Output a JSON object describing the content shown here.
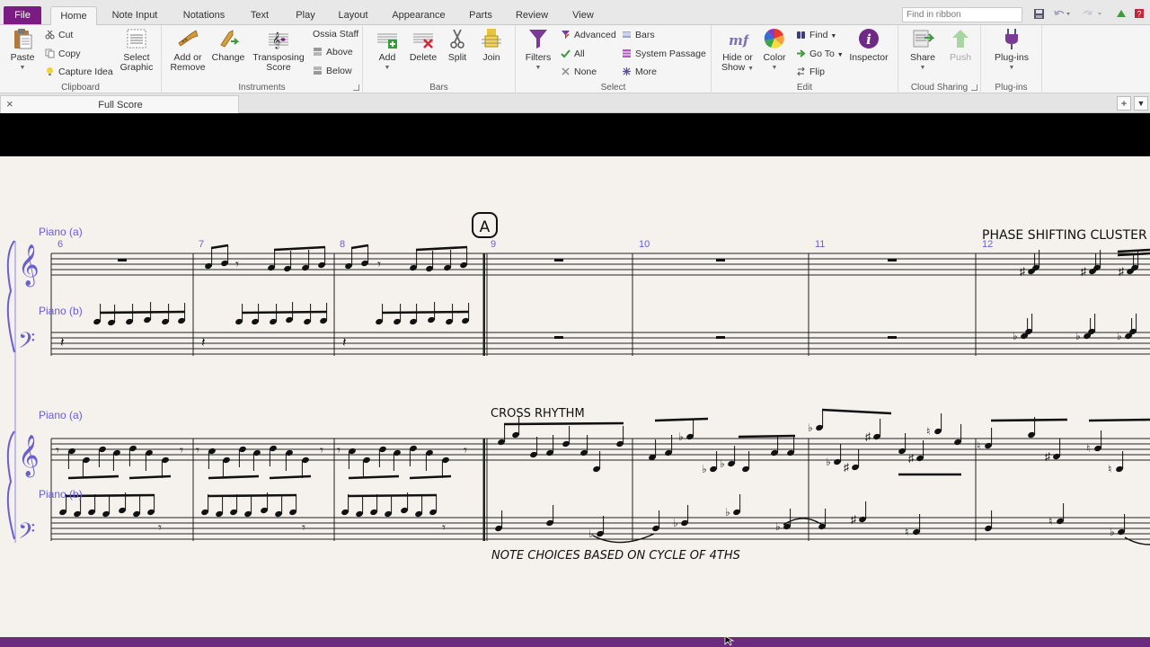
{
  "tabs": {
    "file": "File",
    "items": [
      "Home",
      "Note Input",
      "Notations",
      "Text",
      "Play",
      "Layout",
      "Appearance",
      "Parts",
      "Review",
      "View"
    ],
    "active": "Home"
  },
  "search": {
    "placeholder": "Find in ribbon"
  },
  "ribbon": {
    "clipboard": {
      "label": "Clipboard",
      "paste": "Paste",
      "cut": "Cut",
      "copy": "Copy",
      "capture_idea": "Capture Idea",
      "select_graphic_1": "Select",
      "select_graphic_2": "Graphic"
    },
    "instruments": {
      "label": "Instruments",
      "add_remove_1": "Add or",
      "add_remove_2": "Remove",
      "change": "Change",
      "transposing_1": "Transposing",
      "transposing_2": "Score",
      "ossia": "Ossia Staff",
      "above": "Above",
      "below": "Below"
    },
    "bars": {
      "label": "Bars",
      "add": "Add",
      "delete": "Delete",
      "split": "Split",
      "join": "Join"
    },
    "select": {
      "label": "Select",
      "filters": "Filters",
      "advanced": "Advanced",
      "all": "All",
      "none": "None",
      "bars": "Bars",
      "system_passage": "System Passage",
      "more": "More"
    },
    "edit": {
      "label": "Edit",
      "hide_show_1": "Hide or",
      "hide_show_2": "Show",
      "color": "Color",
      "find": "Find",
      "goto": "Go To",
      "flip": "Flip",
      "inspector": "Inspector"
    },
    "cloud": {
      "label": "Cloud Sharing",
      "share": "Share",
      "push": "Push"
    },
    "plugins": {
      "label": "Plug-ins",
      "plugins": "Plug-ins"
    }
  },
  "document": {
    "tab": "Full Score"
  },
  "score": {
    "instruments": [
      "Piano (a)",
      "Piano (b)"
    ],
    "bar_numbers_system1": [
      "6",
      "7",
      "8",
      "9",
      "10",
      "11",
      "12"
    ],
    "rehearsal_mark": "A",
    "texts": {
      "phase": "PHASE SHIFTING CLUSTER C",
      "cross": "CROSS RHYTHM",
      "notes": "NOTE CHOICES BASED ON CYCLE OF 4THS"
    }
  },
  "colors": {
    "file_tab": "#7a1c82",
    "staff_names": "#6a5fd0",
    "status_bar": "#6b2b7e"
  }
}
